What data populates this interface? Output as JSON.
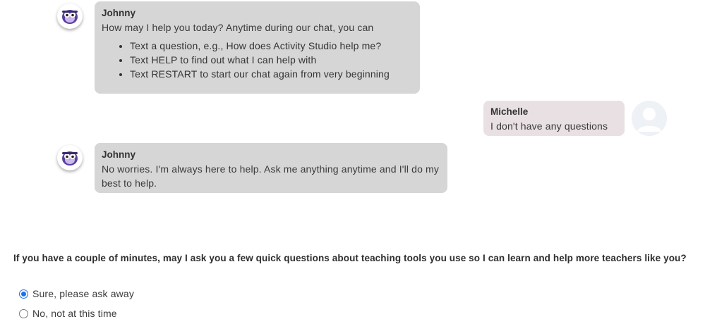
{
  "messages": [
    {
      "sender": "Johnny",
      "text": "How may I help you today? Anytime during our chat, you can",
      "items": [
        "Text a question, e.g., How does Activity Studio help me?",
        "Text HELP to find out what I can help with",
        "Text RESTART to start our chat again from very beginning"
      ]
    },
    {
      "sender": "Michelle",
      "text": "I don't have any questions"
    },
    {
      "sender": "Johnny",
      "text": "No worries. I'm always here to help. Ask me anything anytime and I'll do my best to help."
    }
  ],
  "survey": {
    "question": "If you have a couple of minutes, may I ask you a few quick questions about teaching tools you use so I can learn and help more teachers like you?",
    "options": [
      {
        "label": "Sure, please ask away",
        "selected": true
      },
      {
        "label": "No, not at this time",
        "selected": false
      }
    ]
  },
  "colors": {
    "bot_bubble": "#d6d6d6",
    "user_bubble": "#e8e0e3",
    "radio_accent": "#1a73e8",
    "mascot": "#5b3f9e"
  },
  "icons": {
    "bot_avatar": "owl-mascot-icon",
    "user_avatar": "default-user-icon"
  }
}
